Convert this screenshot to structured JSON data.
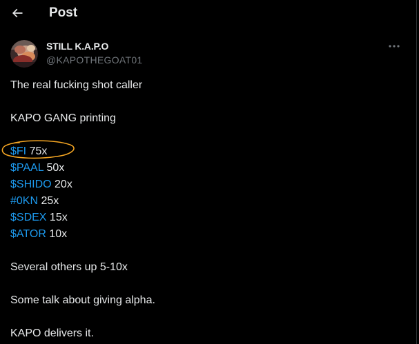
{
  "header": {
    "title": "Post"
  },
  "post": {
    "display_name": "STILL K.A.P.O",
    "handle": "@KAPOTHEGOAT01",
    "lines": {
      "l1": "The real fucking shot caller",
      "l2": "KAPO GANG printing",
      "l3_tag": "$FI",
      "l3_rest": " 75x",
      "l4_tag": "$PAAL",
      "l4_rest": " 50x",
      "l5_tag": "$SHIDO",
      "l5_rest": " 20x",
      "l6_tag": "#0KN",
      "l6_rest": " 25x",
      "l7_tag": "$SDEX",
      "l7_rest": " 15x",
      "l8_tag": "$ATOR",
      "l8_rest": " 10x",
      "l9": "Several others up 5-10x",
      "l10": "Some talk about giving alpha.",
      "l11": "KAPO delivers it."
    }
  },
  "colors": {
    "background": "#000000",
    "text": "#e7e9ea",
    "muted": "#71767b",
    "link": "#1d9bf0",
    "annotation": "#f5a623"
  },
  "icons": {
    "back": "arrow-left-icon",
    "more": "more-horizontal-icon"
  }
}
